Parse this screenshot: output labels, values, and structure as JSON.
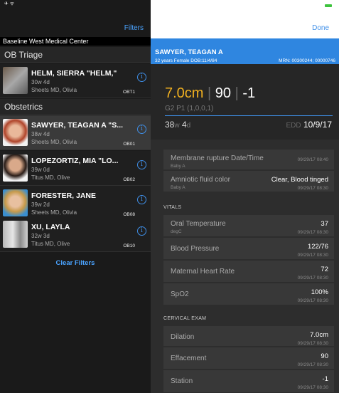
{
  "left": {
    "status": "✈ ᯤ",
    "filters_label": "Filters",
    "facility": "Baseline West Medical Center",
    "sections": [
      {
        "title": "OB Triage"
      },
      {
        "title": "Obstetrics"
      }
    ],
    "patients": [
      {
        "name": "HELM, SIERRA \"HELM,\"",
        "ga": "30w 4d",
        "provider": "Sheets MD, Olivia",
        "bed": "OBT1"
      },
      {
        "name": "SAWYER, TEAGAN A \"S...",
        "ga": "38w 4d",
        "provider": "Sheets MD, Olivia",
        "bed": "OB01"
      },
      {
        "name": "LOPEZORTIZ, MIA \"LO...",
        "ga": "39w 0d",
        "provider": "Titus MD, Olive",
        "bed": "OB02"
      },
      {
        "name": "FORESTER, JANE",
        "ga": "39w 2d",
        "provider": "Sheets MD, Olivia",
        "bed": "OB08"
      },
      {
        "name": "XU, LAYLA",
        "ga": "32w 3d",
        "provider": "Titus MD, Olive",
        "bed": "OB10"
      }
    ],
    "clear_filters": "Clear Filters"
  },
  "right": {
    "done_label": "Done",
    "banner": {
      "name": "SAWYER, TEAGAN A",
      "demo": "32 years  Female  DOB:11/4/84",
      "mrn": "MRN: 00300244; 00000746"
    },
    "summary": {
      "dilation": "7.0cm",
      "effacement": "90",
      "station": "-1",
      "sep": "|",
      "gp": "G2 P1 (1,0,0,1)",
      "ga_w": "38",
      "ga_w_unit": "w",
      "ga_d": "4",
      "ga_d_unit": "d",
      "edd_label": "EDD",
      "edd": "10/9/17"
    },
    "membrane": [
      {
        "label": "Membrane rupture Date/Time",
        "sub": "Baby A",
        "value": "",
        "time": "09/29/17 08:40"
      },
      {
        "label": "Amniotic fluid color",
        "sub": "Baby A",
        "value": "Clear, Blood tinged",
        "time": "09/29/17 08:30"
      }
    ],
    "vitals_header": "VITALS",
    "vitals": [
      {
        "label": "Oral Temperature",
        "sub": "degC",
        "value": "37",
        "time": "09/29/17 08:30"
      },
      {
        "label": "Blood Pressure",
        "sub": "",
        "value": "122/76",
        "time": "09/29/17 08:30"
      },
      {
        "label": "Maternal Heart Rate",
        "sub": "",
        "value": "72",
        "time": "09/29/17 08:30"
      },
      {
        "label": "SpO2",
        "sub": "",
        "value": "100%",
        "time": "09/29/17 08:30"
      }
    ],
    "cervical_header": "CERVICAL EXAM",
    "cervical": [
      {
        "label": "Dilation",
        "value": "7.0cm",
        "time": "09/29/17 08:30"
      },
      {
        "label": "Effacement",
        "value": "90",
        "time": "09/29/17 08:30"
      },
      {
        "label": "Station",
        "value": "-1",
        "time": "09/29/17 08:30"
      }
    ]
  },
  "colors": {
    "accent": "#2f86e0",
    "dilation": "#f0b020",
    "battery": "#3ec33e"
  }
}
